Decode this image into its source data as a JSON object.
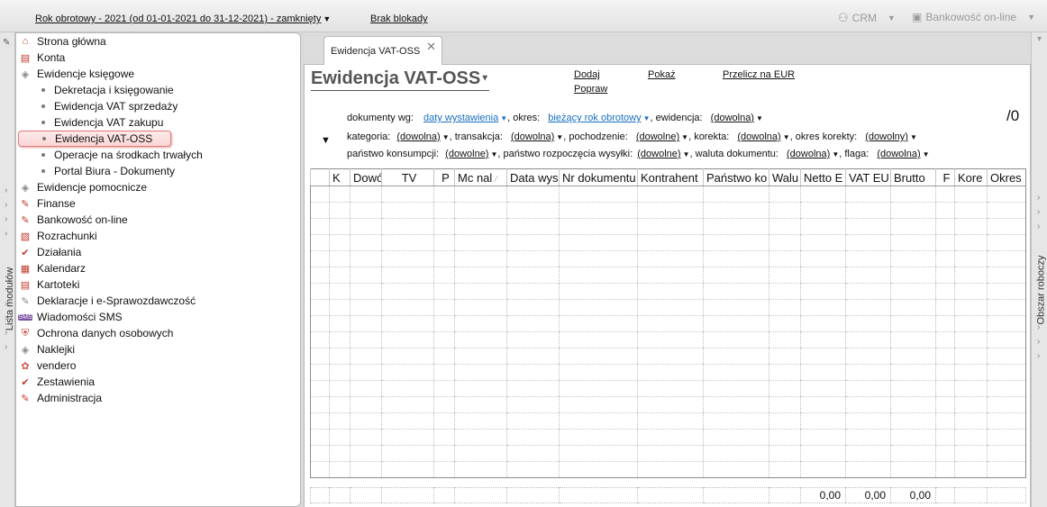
{
  "topbar": {
    "fiscal_year": "Rok obrotowy - 2021  (od 01-01-2021 do 31-12-2021) - zamknięty",
    "lock_status": "Brak blokady",
    "crm_label": "CRM",
    "bank_label": "Bankowość on-line"
  },
  "left_strip": {
    "label": "Lista modułów"
  },
  "right_strip": {
    "label": "Obszar roboczy"
  },
  "sidebar": {
    "items": [
      {
        "label": "Strona główna",
        "icon": "home-icon"
      },
      {
        "label": "Konta",
        "icon": "accounts-icon"
      },
      {
        "label": "Ewidencje księgowe",
        "icon": "ledger-icon"
      },
      {
        "label": "Ewidencje pomocnicze",
        "icon": "aux-ledger-icon"
      },
      {
        "label": "Finanse",
        "icon": "finance-icon"
      },
      {
        "label": "Bankowość on-line",
        "icon": "bank-icon"
      },
      {
        "label": "Rozrachunki",
        "icon": "settlements-icon"
      },
      {
        "label": "Działania",
        "icon": "actions-icon"
      },
      {
        "label": "Kalendarz",
        "icon": "calendar-icon"
      },
      {
        "label": "Kartoteki",
        "icon": "files-icon"
      },
      {
        "label": "Deklaracje i e-Sprawozdawczość",
        "icon": "declarations-icon"
      },
      {
        "label": "Wiadomości SMS",
        "icon": "sms-icon"
      },
      {
        "label": "Ochrona danych osobowych",
        "icon": "privacy-icon"
      },
      {
        "label": "Naklejki",
        "icon": "stickers-icon"
      },
      {
        "label": "vendero",
        "icon": "vendero-icon"
      },
      {
        "label": "Zestawienia",
        "icon": "reports-icon"
      },
      {
        "label": "Administracja",
        "icon": "admin-icon"
      }
    ],
    "subitems": [
      {
        "label": "Dekretacja i księgowanie"
      },
      {
        "label": "Ewidencja VAT sprzedaży"
      },
      {
        "label": "Ewidencja VAT zakupu"
      },
      {
        "label": "Ewidencja VAT-OSS"
      },
      {
        "label": "Operacje na środkach trwałych"
      },
      {
        "label": "Portal Biura - Dokumenty"
      }
    ]
  },
  "tab": {
    "label": "Ewidencja VAT-OSS"
  },
  "page": {
    "title": "Ewidencja VAT-OSS",
    "actions": {
      "add": "Dodaj",
      "edit": "Popraw",
      "show": "Pokaż",
      "recalc": "Przelicz na EUR"
    },
    "counter": "/0"
  },
  "filters": {
    "docs_by_label": "dokumenty wg:",
    "docs_by_value": "daty wystawienia",
    "period_label": ", okres:",
    "period_value": "bieżący rok obrotowy",
    "register_label": ", ewidencja:",
    "register_value": "(dowolna)",
    "category_label": "kategoria:",
    "category_value": "(dowolna)",
    "transaction_label": ", transakcja:",
    "transaction_value": "(dowolna)",
    "origin_label": ", pochodzenie:",
    "origin_value": "(dowolne)",
    "correction_label": ", korekta:",
    "correction_value": "(dowolna)",
    "correction_period_label": ", okres korekty:",
    "correction_period_value": "(dowolny)",
    "consumption_country_label": "państwo konsumpcji:",
    "consumption_country_value": "(dowolne)",
    "shipping_country_label": ", państwo rozpoczęcia wysyłki:",
    "shipping_country_value": "(dowolne)",
    "currency_label": ", waluta dokumentu:",
    "currency_value": "(dowolna)",
    "flag_label": ", flaga:",
    "flag_value": "(dowolna)"
  },
  "table": {
    "columns": [
      "",
      "K",
      "Dowó",
      "TV",
      "P",
      "Mc nal",
      "Data wys",
      "Nr dokumentu",
      "Kontrahent",
      "Państwo ko",
      "Walu",
      "Netto E",
      "VAT EU",
      "Brutto",
      "F",
      "Kore",
      "Okres"
    ],
    "row_count": 18
  },
  "totals": {
    "netto": "0,00",
    "vat": "0,00",
    "brutto": "0,00"
  }
}
